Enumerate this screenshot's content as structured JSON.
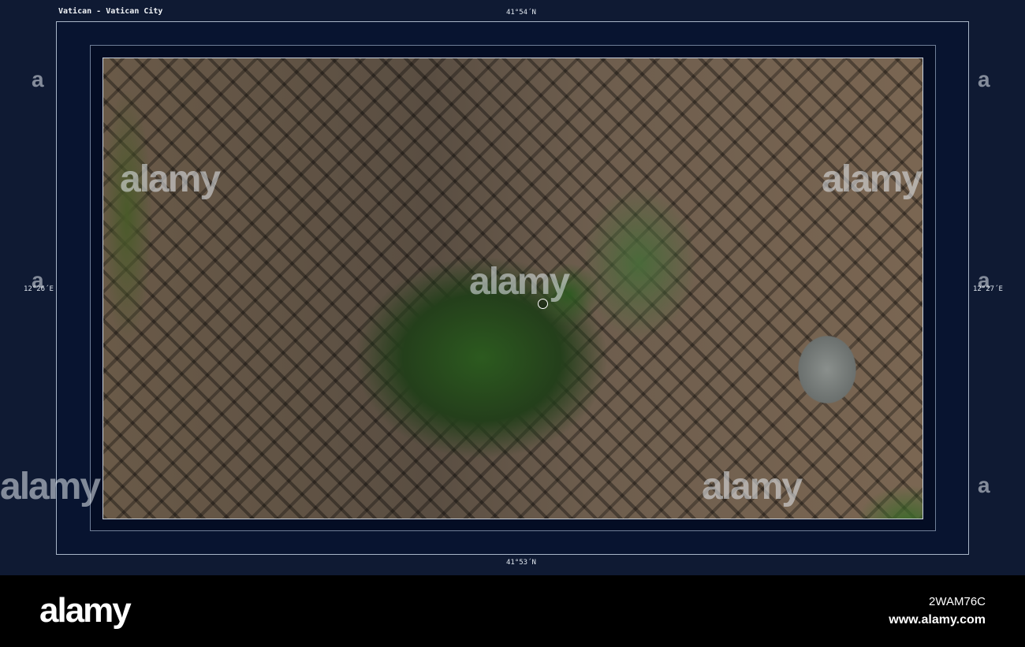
{
  "map": {
    "title": "Vatican - Vatican City",
    "lat_top": "41°54´N",
    "lat_bottom": "41°53´N",
    "lon_left": "12°26´E",
    "lon_right": "12°27´E",
    "marker_icon": "location-circle-icon"
  },
  "watermark": {
    "text": "alamy",
    "letter": "a"
  },
  "footer": {
    "logo": "alamy",
    "image_code": "2WAM76C",
    "url": "www.alamy.com"
  },
  "colors": {
    "frame": "#0f1a33",
    "footer": "#000000"
  }
}
